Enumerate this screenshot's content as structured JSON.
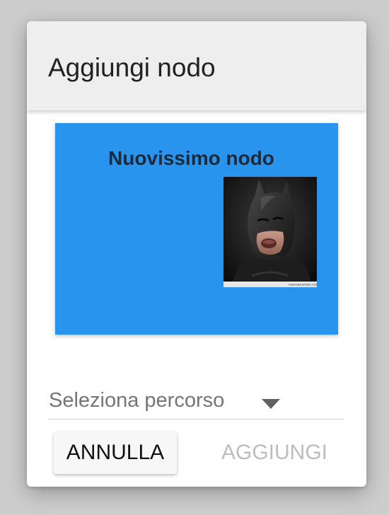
{
  "dialog": {
    "title": "Aggiungi nodo"
  },
  "preview": {
    "node_title": "Nuovissimo nodo",
    "card_color": "#2994ee"
  },
  "path_select": {
    "placeholder": "Seleziona percorso"
  },
  "actions": {
    "cancel_label": "ANNULLA",
    "add_label": "AGGIUNGI",
    "add_disabled": true
  }
}
